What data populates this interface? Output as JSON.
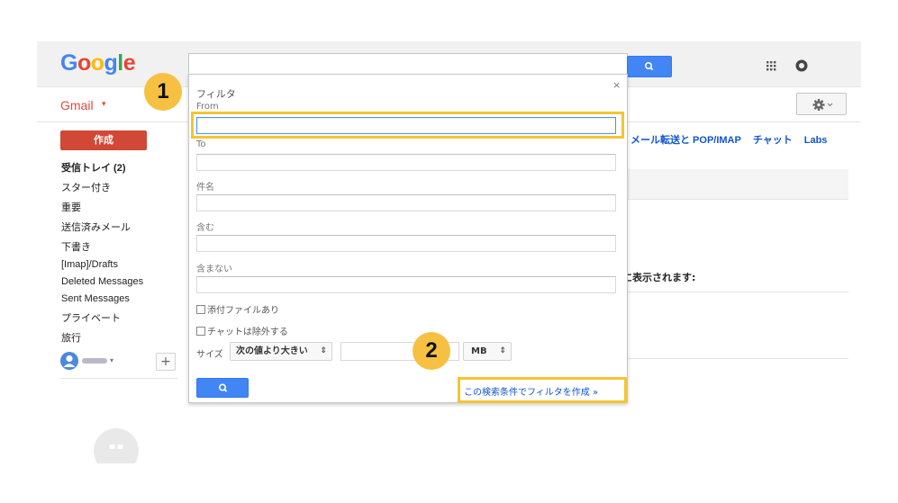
{
  "header": {
    "logo_letters": [
      {
        "char": "G",
        "color": "#4285f4"
      },
      {
        "char": "o",
        "color": "#ea4335"
      },
      {
        "char": "o",
        "color": "#fbbc05"
      },
      {
        "char": "g",
        "color": "#4285f4"
      },
      {
        "char": "l",
        "color": "#34a853"
      },
      {
        "char": "e",
        "color": "#ea4335"
      }
    ],
    "apps_icon": "apps-grid-icon",
    "account_icon": "account-icon"
  },
  "gmail_menu": {
    "label": "Gmail",
    "caret": "▾"
  },
  "settings": {
    "gear_icon": "gear-icon",
    "tabs": [
      "メール転送と POP/IMAP",
      "チャット",
      "Labs"
    ],
    "partial_text": "に表示されます:"
  },
  "sidebar": {
    "compose_label": "作成",
    "items": [
      {
        "label": "受信トレイ (2)",
        "bold": true
      },
      {
        "label": "スター付き",
        "bold": false
      },
      {
        "label": "重要",
        "bold": false
      },
      {
        "label": "送信済みメール",
        "bold": false
      },
      {
        "label": "下書き",
        "bold": false
      },
      {
        "label": "[Imap]/Drafts",
        "bold": false
      },
      {
        "label": "Deleted Messages",
        "bold": false
      },
      {
        "label": "Sent Messages",
        "bold": false
      },
      {
        "label": "プライベート",
        "bold": false
      },
      {
        "label": "旅行",
        "bold": false
      }
    ],
    "add_button": "+"
  },
  "filter_dialog": {
    "title": "フィルタ",
    "close": "×",
    "fields": [
      {
        "label": "From",
        "value": ""
      },
      {
        "label": "To",
        "value": ""
      },
      {
        "label": "件名",
        "value": ""
      },
      {
        "label": "含む",
        "value": ""
      },
      {
        "label": "含まない",
        "value": ""
      }
    ],
    "checkboxes": [
      {
        "label": "添付ファイルあり",
        "checked": false
      },
      {
        "label": "チャットは除外する",
        "checked": false
      }
    ],
    "size_label": "サイズ",
    "size_operator": "次の値より大きい",
    "size_value": "",
    "size_unit": "MB",
    "search_icon": "search-icon",
    "create_filter_link": "この検索条件でフィルタを作成 »"
  },
  "annotations": {
    "badge_1": "1",
    "badge_2": "2",
    "highlight_color": "#f4c531"
  }
}
